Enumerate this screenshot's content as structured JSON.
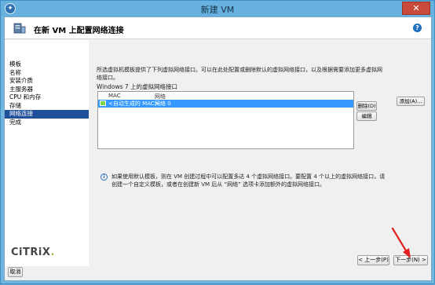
{
  "window": {
    "title": "新建 VM",
    "close_label": "✕"
  },
  "header": {
    "title": "在新 VM 上配置网络连接",
    "help_label": "?"
  },
  "sidebar": {
    "steps": [
      {
        "label": "模板"
      },
      {
        "label": "名称"
      },
      {
        "label": "安装介质"
      },
      {
        "label": "主服务器"
      },
      {
        "label": "CPU 和内存"
      },
      {
        "label": "存储"
      },
      {
        "label": "网络连接"
      },
      {
        "label": "完成"
      }
    ],
    "active_index": 6,
    "logo_text": "CiTRiX",
    "logo_dot": "."
  },
  "main": {
    "description": "所选虚拟机模板提供了下列虚拟网络接口。可以在此处配置或删除默认的虚拟网络接口，以及根据需要添加更多虚拟网络接口。",
    "list_label": "Windows 7 上的虚拟网络接口",
    "columns": {
      "mac": "MAC",
      "network": "网络"
    },
    "rows": [
      {
        "mac": "<自动生成的 MAC>",
        "network": "网络 0"
      }
    ],
    "buttons": {
      "delete": "删除(D)",
      "edit": "编辑",
      "add": "添加(A)..."
    },
    "info_icon": "i",
    "info_text": "如果使用默认模板，则在 VM 创建过程中可以配置多达 4 个虚拟网络接口。要配置 4 个以上的虚拟网络接口，请创建一个自定义模板，或者在创建新 VM 后从 “网络” 选项卡添加额外的虚拟网络接口。"
  },
  "footer": {
    "prev": "< 上一步(P)",
    "next": "下一步(N) >",
    "cancel": "取消"
  },
  "colors": {
    "selection": "#3399ff",
    "active_step": "#1f4e9a",
    "titlebar": "#66b1de",
    "annotation_arrow": "#e02020"
  }
}
